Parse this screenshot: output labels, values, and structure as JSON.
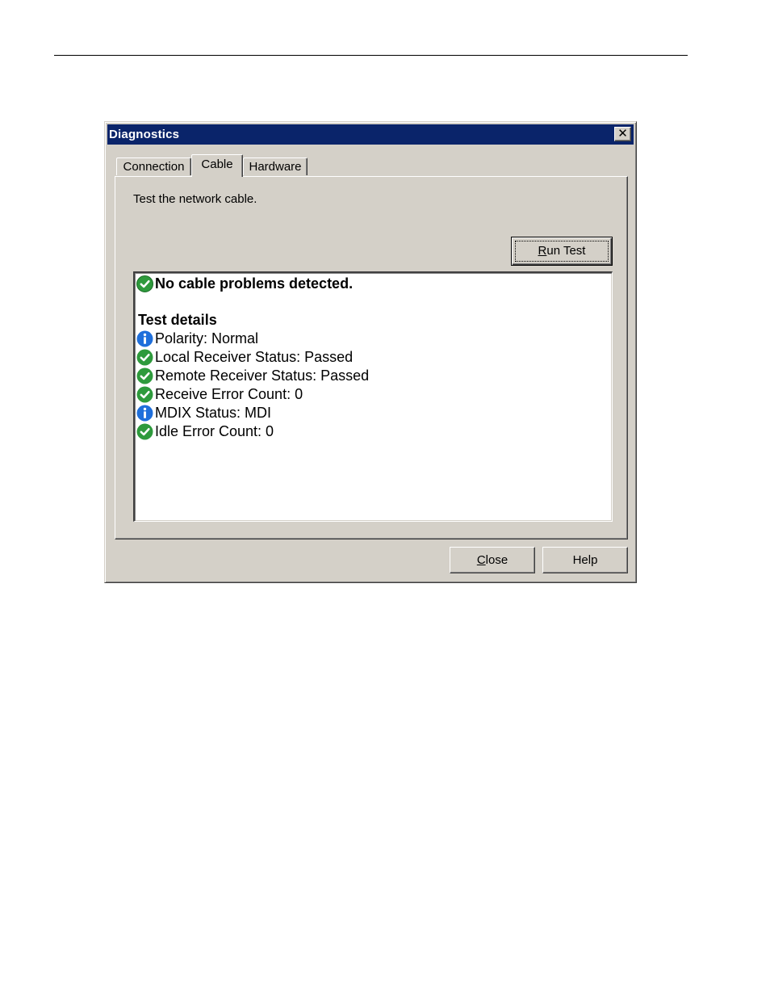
{
  "dialog": {
    "title": "Diagnostics",
    "close_glyph": "✕"
  },
  "tabs": [
    {
      "label": "Connection",
      "active": false
    },
    {
      "label": "Cable",
      "active": true
    },
    {
      "label": "Hardware",
      "active": false
    }
  ],
  "cable_tab": {
    "description": "Test the network cable.",
    "run_test": {
      "mnemonic": "R",
      "rest": "un Test"
    },
    "summary": {
      "icon": "check-icon",
      "text": "No cable problems detected."
    },
    "details_heading": "Test details",
    "details": [
      {
        "icon": "info-icon",
        "text": "Polarity:  Normal"
      },
      {
        "icon": "check-icon",
        "text": "Local Receiver Status:  Passed"
      },
      {
        "icon": "check-icon",
        "text": "Remote Receiver Status:  Passed"
      },
      {
        "icon": "check-icon",
        "text": "Receive Error Count:  0"
      },
      {
        "icon": "info-icon",
        "text": "MDIX Status:  MDI"
      },
      {
        "icon": "check-icon",
        "text": "Idle Error Count:  0"
      }
    ]
  },
  "footer": {
    "close": {
      "mnemonic": "C",
      "rest": "lose"
    },
    "help": "Help"
  },
  "colors": {
    "titlebar": "#0a246a",
    "dialog_face": "#d4d0c8",
    "check_green": "#2e9a3c",
    "info_blue": "#1f6fdb"
  }
}
